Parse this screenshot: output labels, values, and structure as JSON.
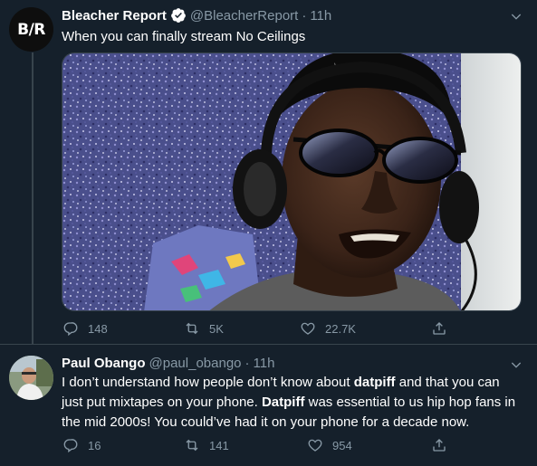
{
  "tweets": [
    {
      "author_name": "Bleacher Report",
      "handle": "@BleacherReport",
      "dot": "·",
      "time": "11h",
      "avatar_text": "B/R",
      "text": "When you can finally stream No Ceilings",
      "actions": {
        "replies": "148",
        "retweets": "5K",
        "likes": "22.7K"
      }
    },
    {
      "author_name": "Paul Obango",
      "handle": "@paul_obango",
      "dot": "·",
      "time": "11h",
      "text_parts": [
        "I don’t understand how people don’t know about ",
        "datpiff",
        " and that you can just put mixtapes on your phone. ",
        "Datpiff",
        " was essential to us hip hop fans in the mid 2000s! You could’ve had it on your phone for a decade now."
      ],
      "actions": {
        "replies": "16",
        "retweets": "141",
        "likes": "954"
      }
    }
  ],
  "colors": {
    "background": "#15202b",
    "secondary_text": "#8899a6",
    "border": "#38444d",
    "verified": "#ffffff"
  },
  "icons": {
    "verified": "verified-badge-icon",
    "caret": "chevron-down-icon",
    "reply": "reply-icon",
    "retweet": "retweet-icon",
    "like": "heart-icon",
    "share": "share-icon"
  }
}
